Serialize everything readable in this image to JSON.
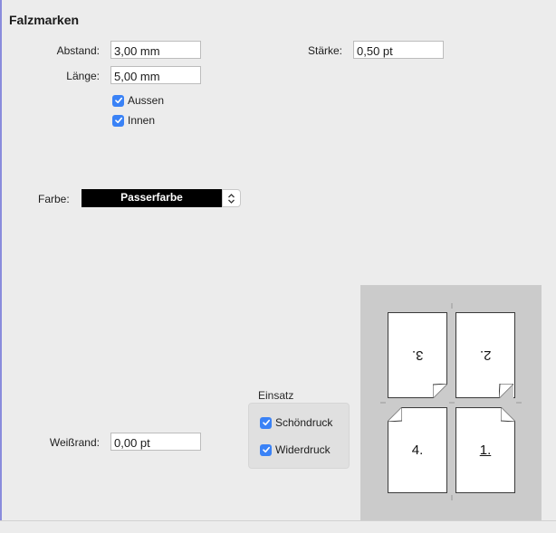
{
  "title": "Falzmarken",
  "abstand": {
    "label": "Abstand:",
    "value": "3,00 mm"
  },
  "laenge": {
    "label": "Länge:",
    "value": "5,00 mm"
  },
  "staerke": {
    "label": "Stärke:",
    "value": "0,50 pt"
  },
  "aussen": {
    "label": "Aussen",
    "checked": true
  },
  "innen": {
    "label": "Innen",
    "checked": true
  },
  "farbe": {
    "label": "Farbe:",
    "value": "Passerfarbe",
    "icon": "stepper-icon"
  },
  "weissrand": {
    "label": "Weißrand:",
    "value": "0,00 pt"
  },
  "einsatz": {
    "title": "Einsatz",
    "schoendruck": {
      "label": "Schöndruck",
      "checked": true
    },
    "widerdruck": {
      "label": "Widerdruck",
      "checked": true
    }
  },
  "preview": {
    "pages": [
      {
        "label": "3.",
        "rotated": true,
        "underlined": false
      },
      {
        "label": "2.",
        "rotated": true,
        "underlined": false
      },
      {
        "label": "4.",
        "rotated": false,
        "underlined": false
      },
      {
        "label": "1.",
        "rotated": false,
        "underlined": true
      }
    ]
  },
  "colors": {
    "checkbox": "#3a82f6",
    "swatch": "#000000",
    "preview_bg": "#cbcbcb"
  }
}
